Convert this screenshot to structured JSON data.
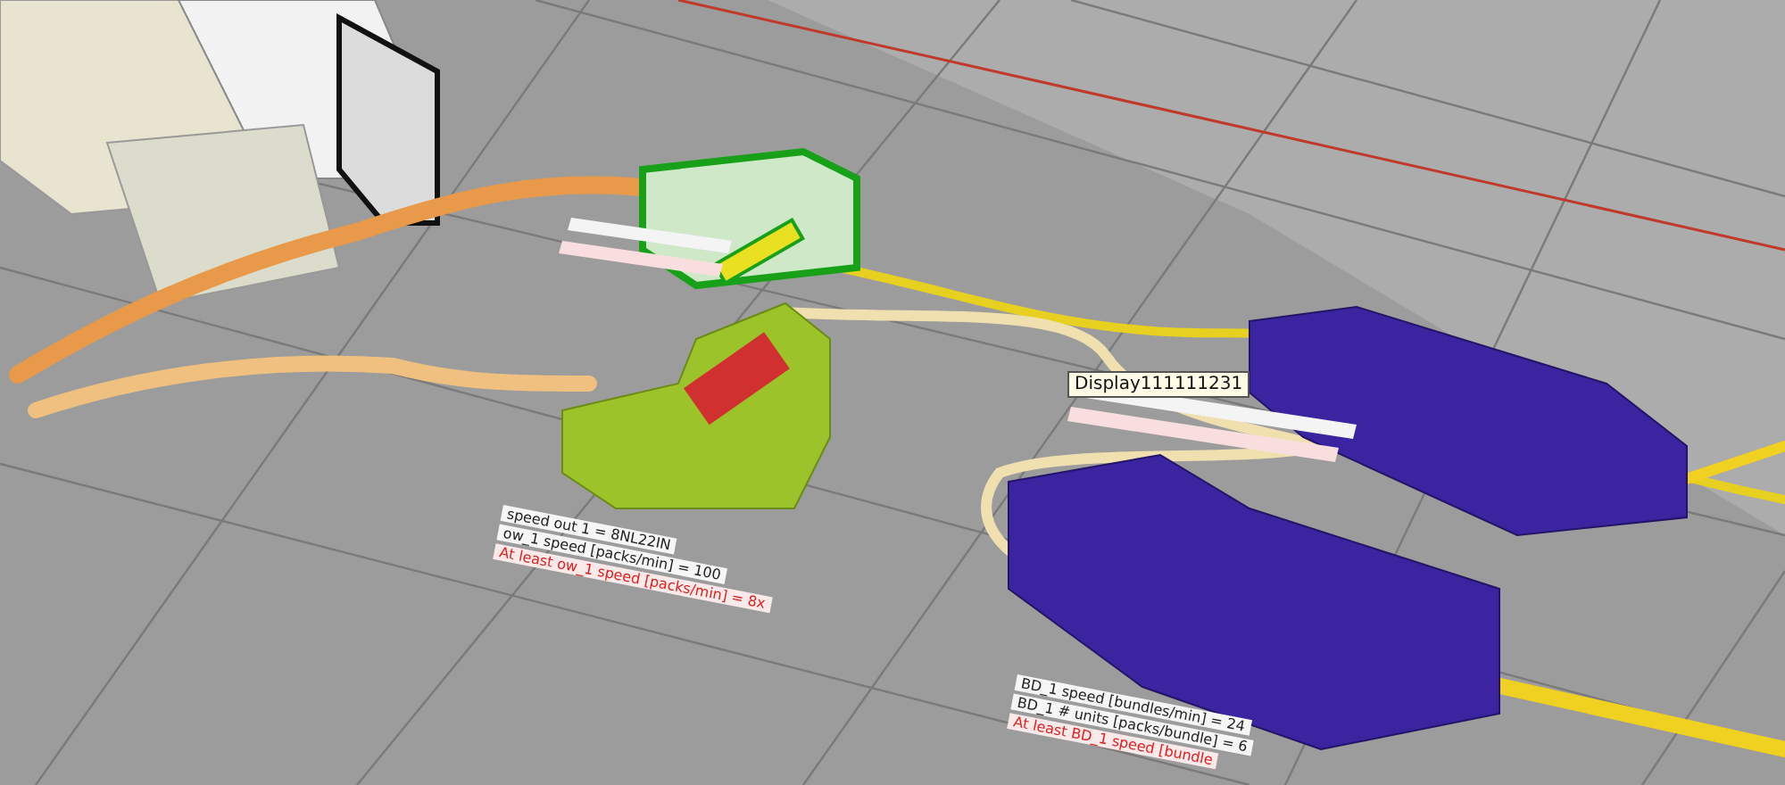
{
  "scene": {
    "tooltip": "Display111111231"
  },
  "label_groups": [
    {
      "lines": [
        {
          "text": "speed out 1 = 8NL22IN",
          "kind": "info"
        },
        {
          "text": "ow_1 speed [packs/min] = 100",
          "kind": "info"
        },
        {
          "text": "At least ow_1 speed [packs/min] = 8x",
          "kind": "warning"
        }
      ]
    },
    {
      "lines": [
        {
          "text": "BD_1 speed [bundles/min] = 24",
          "kind": "info"
        },
        {
          "text": "BD_1 # units [packs/bundle] = 6",
          "kind": "info"
        },
        {
          "text": "At least BD_1 speed [bundle",
          "kind": "warning"
        }
      ]
    }
  ]
}
